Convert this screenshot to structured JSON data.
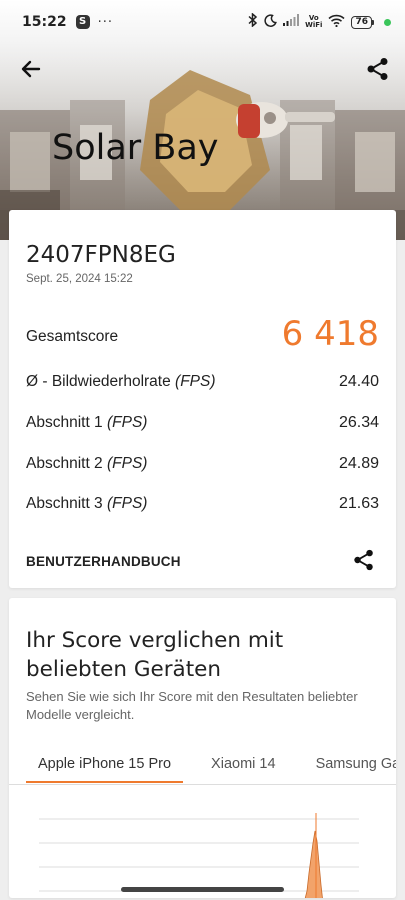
{
  "status_bar": {
    "time": "15:22",
    "app_badge": "S",
    "more": "···",
    "vowifi_top": "Vo",
    "vowifi_bottom": "WiFi",
    "battery_level": "76"
  },
  "header": {
    "title": "Solar Bay",
    "back_icon": "arrow-left-icon",
    "share_icon": "share-icon"
  },
  "result": {
    "device": "2407FPN8EG",
    "date": "Sept. 25, 2024 15:22",
    "total_label": "Gesamtscore",
    "total_value": "6 418",
    "rows": [
      {
        "label": "Ø - Bildwiederholrate ",
        "unit": "(FPS)",
        "value": "24.40"
      },
      {
        "label": "Abschnitt 1 ",
        "unit": "(FPS)",
        "value": "26.34"
      },
      {
        "label": "Abschnitt 2 ",
        "unit": "(FPS)",
        "value": "24.89"
      },
      {
        "label": "Abschnitt 3 ",
        "unit": "(FPS)",
        "value": "21.63"
      }
    ],
    "manual_label": "BENUTZERHANDBUCH"
  },
  "comparison": {
    "title": "Ihr Score verglichen mit beliebten Geräten",
    "description": "Sehen Sie wie sich Ihr Score mit den Resultaten beliebter Modelle vergleicht.",
    "tabs": [
      "Apple iPhone 15 Pro",
      "Xiaomi 14",
      "Samsung Galaxy"
    ],
    "active_tab": 0
  },
  "colors": {
    "accent": "#ef7a2e",
    "chart_fill": "#f2a36a"
  }
}
